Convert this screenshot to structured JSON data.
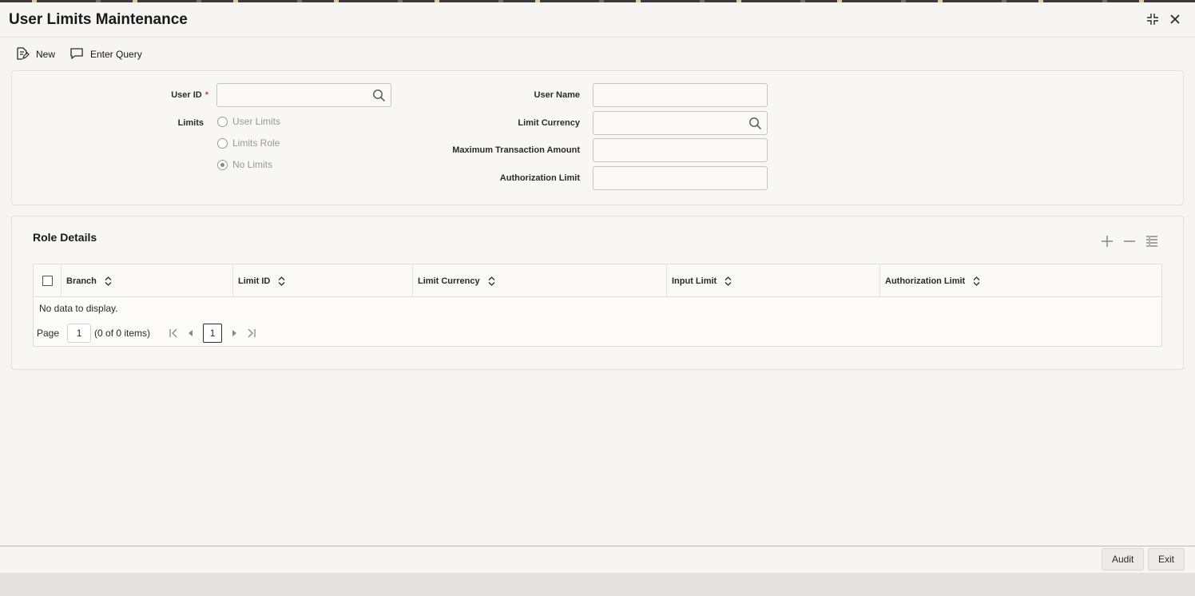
{
  "window": {
    "title": "User Limits Maintenance"
  },
  "toolbar": {
    "new_label": "New",
    "enter_query_label": "Enter Query"
  },
  "form": {
    "user_id_label": "User ID",
    "user_id_required": "*",
    "user_id_value": "",
    "limits_label": "Limits",
    "limits_options": [
      "User Limits",
      "Limits Role",
      "No Limits"
    ],
    "limits_selected": "No Limits",
    "user_name_label": "User Name",
    "user_name_value": "",
    "limit_currency_label": "Limit Currency",
    "limit_currency_value": "",
    "max_txn_amount_label": "Maximum Transaction Amount",
    "max_txn_amount_value": "",
    "auth_limit_label": "Authorization Limit",
    "auth_limit_value": ""
  },
  "role_details": {
    "title": "Role Details",
    "columns": [
      "Branch",
      "Limit ID",
      "Limit Currency",
      "Input Limit",
      "Authorization Limit"
    ],
    "rows": [],
    "empty_text": "No data to display.",
    "pager": {
      "page_label": "Page",
      "page_value": "1",
      "items_text": "(0 of 0 items)",
      "current_page": "1"
    }
  },
  "footer": {
    "audit_label": "Audit",
    "exit_label": "Exit"
  },
  "icons": {
    "new": "new-document-icon",
    "enter_query": "comment-icon",
    "collapse": "collapse-icon",
    "close": "close-icon",
    "search": "search-icon",
    "add_row": "plus-icon",
    "remove_row": "minus-icon",
    "single_view": "list-detail-icon",
    "sort": "sort-icon"
  },
  "colors": {
    "required_marker": "#c74634",
    "background": "#f6f5f3"
  }
}
